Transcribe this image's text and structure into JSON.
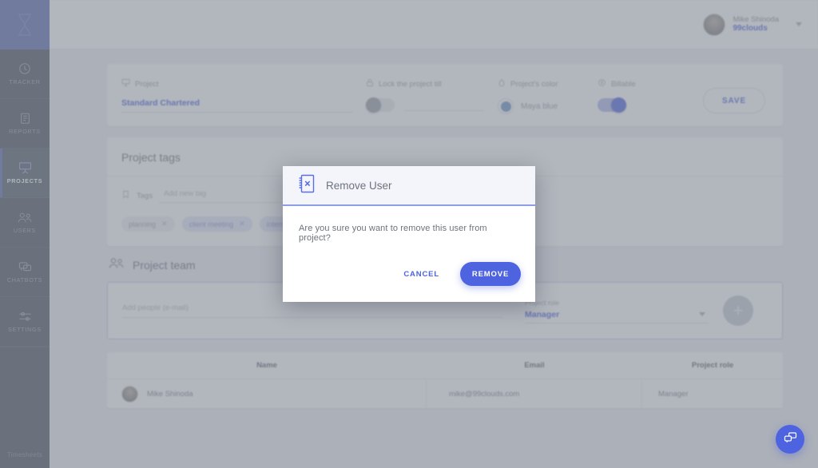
{
  "app": {
    "logo_icon": "hourglass-icon"
  },
  "sidebar": {
    "items": [
      {
        "label": "TRACKER",
        "icon": "clock-icon",
        "active": false
      },
      {
        "label": "REPORTS",
        "icon": "clipboard-icon",
        "active": false
      },
      {
        "label": "PROJECTS",
        "icon": "board-icon",
        "active": true
      },
      {
        "label": "USERS",
        "icon": "users-icon",
        "active": false
      },
      {
        "label": "CHATBOTS",
        "icon": "chat-icon",
        "active": false
      },
      {
        "label": "SETTINGS",
        "icon": "sliders-icon",
        "active": false
      }
    ],
    "footer_label": "Timesheets"
  },
  "topbar": {
    "user_name": "Mike Shinoda",
    "user_org": "99clouds",
    "avatar_icon": "avatar",
    "caret_icon": "chevron-down-icon"
  },
  "project_settings": {
    "project_label": "Project",
    "project_icon": "board-icon",
    "project_value": "Standard Chartered",
    "lock_label": "Lock the project till",
    "lock_icon": "lock-icon",
    "lock_enabled": false,
    "color_label": "Project's color",
    "color_icon": "droplet-icon",
    "color_value": "Maya blue",
    "color_hex": "#6e95c6",
    "billable_label": "Billable",
    "billable_icon": "dollar-icon",
    "billable_enabled": true,
    "save_label": "SAVE"
  },
  "project_tags": {
    "title": "Project tags",
    "tags_label": "Tags",
    "tags_icon": "tag-icon",
    "add_tag_placeholder": "Add new tag",
    "chips": [
      {
        "label": "planning",
        "style": "gray",
        "remove_icon": "close-icon"
      },
      {
        "label": "client meeting",
        "style": "blue",
        "remove_icon": "close-icon"
      },
      {
        "label": "internal meeting",
        "style": "blue",
        "remove_icon": "close-icon"
      }
    ]
  },
  "project_team": {
    "title": "Project team",
    "title_icon": "users-icon",
    "add_people_placeholder": "Add people (e-mail)",
    "role_label": "Project role",
    "role_value": "Manager",
    "role_caret_icon": "chevron-down-icon",
    "add_button_icon": "plus-icon"
  },
  "team_table": {
    "columns": [
      "Name",
      "Email",
      "Project role"
    ],
    "rows": [
      {
        "name": "Mike Shinoda",
        "email": "mike@99clouds.com",
        "role": "Manager",
        "avatar_icon": "avatar"
      }
    ]
  },
  "modal": {
    "icon": "remove-user-book-icon",
    "title": "Remove User",
    "message": "Are you sure you want to remove this user from project?",
    "cancel_label": "CANCEL",
    "confirm_label": "REMOVE",
    "accent_hex": "#4e63e0"
  },
  "fab": {
    "icon": "chat-bubbles-icon",
    "color_hex": "#4e63e0"
  }
}
